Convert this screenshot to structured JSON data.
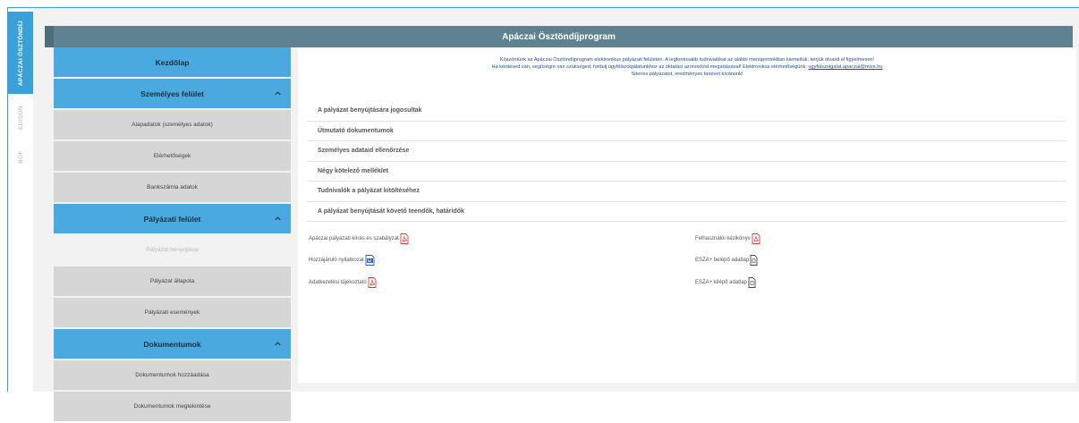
{
  "vertical_tabs": [
    "APÁCZAI ÖSZTÖNDÍJ",
    "EDISON",
    "BÖF"
  ],
  "header": {
    "title": "Apáczai Ösztöndíjprogram"
  },
  "sidebar": {
    "items": [
      {
        "label": "Kezdőlap"
      },
      {
        "label": "Személyes felület"
      },
      {
        "label": "Alapadatok (személyes adatok)"
      },
      {
        "label": "Elérhetőségek"
      },
      {
        "label": "Bankszámla adatok"
      },
      {
        "label": "Pályázati felület"
      },
      {
        "label": "Pályázat benyújtása"
      },
      {
        "label": "Pályázat állapota"
      },
      {
        "label": "Pályázati események"
      },
      {
        "label": "Dokumentumok"
      },
      {
        "label": "Dokumentumok hozzáadása"
      },
      {
        "label": "Dokumentumok megtekintése"
      }
    ]
  },
  "welcome": {
    "line1": "Köszöntünk az Apáczai Ösztöndíjprogram elektronikus pályázati felületén. A legfontosabb tudnivalókat az alábbi menüpontokban kiemeltük, kérjük olvasd el figyelmesen!",
    "line2_prefix": "Ha kérdésed van, segítségre van szükséged, fordulj ügyfélszolgálatunkhoz az oktatási azonosítód megadásával! Elektronikus elérhetőségünk: ",
    "email": "ugyfelszolgalat.apaczai@mive.hu",
    "line3": "Sikeres pályázatot, eredményes tanévet kívánunk!"
  },
  "accordion": {
    "items": [
      {
        "label": "A pályázat benyújtására jogosultak"
      },
      {
        "label": "Útmutató dokumentumok"
      },
      {
        "label": "Személyes adataid ellenőrzése"
      },
      {
        "label": "Négy kötelező melléklet"
      },
      {
        "label": "Tudnivalók a pályázat kitöltéséhez"
      },
      {
        "label": "A pályázat benyújtását követő teendők, határidők"
      }
    ]
  },
  "documents": {
    "items": [
      {
        "label": "Apáczai pályázati kiírás és szabályzat",
        "icon": "pdf-icon"
      },
      {
        "label": "Hozzájáruló nyilatkozat",
        "icon": "word-icon"
      },
      {
        "label": "Adatkezelési tájékoztató",
        "icon": "pdf-icon"
      },
      {
        "label": "Felhasználói kézikönyv",
        "icon": "pdf-icon"
      },
      {
        "label": "ESZA+ belépő adatlap",
        "icon": "file-icon"
      },
      {
        "label": "ESZA+ kilépő adatlap",
        "icon": "file-icon"
      }
    ]
  },
  "colors": {
    "accent_blue": "#4aa9df",
    "header_bg": "#5f8291",
    "link_blue": "#1d4fa0",
    "pdf_red": "#e53935",
    "word_blue": "#2b5cd0"
  }
}
